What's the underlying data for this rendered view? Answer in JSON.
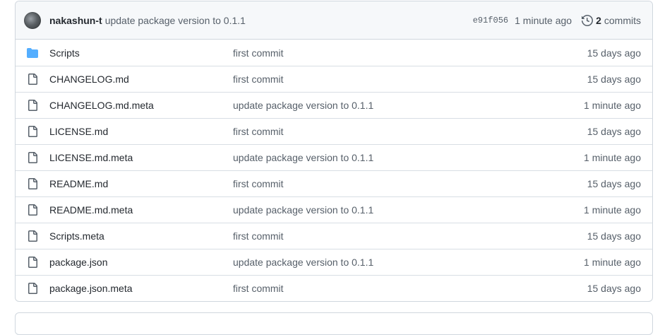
{
  "latest_commit": {
    "author": "nakashun-t",
    "message": "update package version to 0.1.1",
    "sha": "e91f056",
    "time": "1 minute ago",
    "commit_count": "2",
    "commits_label": "commits"
  },
  "files": [
    {
      "name": "Scripts",
      "type": "folder",
      "message": "first commit",
      "age": "15 days ago"
    },
    {
      "name": "CHANGELOG.md",
      "type": "file",
      "message": "first commit",
      "age": "15 days ago"
    },
    {
      "name": "CHANGELOG.md.meta",
      "type": "file",
      "message": "update package version to 0.1.1",
      "age": "1 minute ago"
    },
    {
      "name": "LICENSE.md",
      "type": "file",
      "message": "first commit",
      "age": "15 days ago"
    },
    {
      "name": "LICENSE.md.meta",
      "type": "file",
      "message": "update package version to 0.1.1",
      "age": "1 minute ago"
    },
    {
      "name": "README.md",
      "type": "file",
      "message": "first commit",
      "age": "15 days ago"
    },
    {
      "name": "README.md.meta",
      "type": "file",
      "message": "update package version to 0.1.1",
      "age": "1 minute ago"
    },
    {
      "name": "Scripts.meta",
      "type": "file",
      "message": "first commit",
      "age": "15 days ago"
    },
    {
      "name": "package.json",
      "type": "file",
      "message": "update package version to 0.1.1",
      "age": "1 minute ago"
    },
    {
      "name": "package.json.meta",
      "type": "file",
      "message": "first commit",
      "age": "15 days ago"
    }
  ],
  "colors": {
    "folder": "#54aeff",
    "file_icon": "#57606a",
    "header_bg": "#f6f8fa",
    "border": "#d0d7de"
  },
  "icons": {
    "folder": "folder-icon",
    "file": "file-icon",
    "history": "history-icon"
  }
}
